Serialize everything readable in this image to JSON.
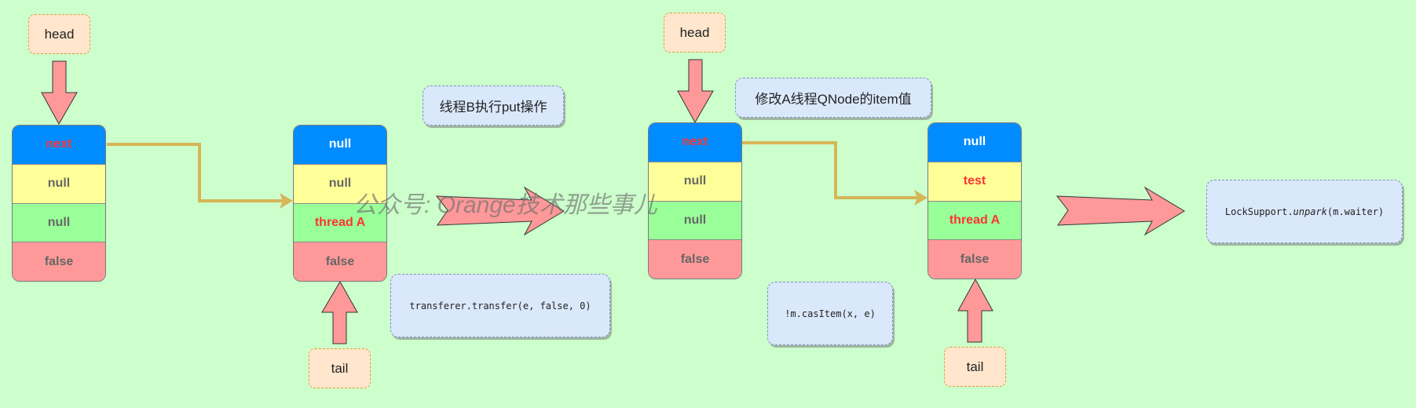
{
  "colors": {
    "background": "#CCFFCC",
    "next_row": "#008CFF",
    "item_row": "#FFFF99",
    "waiter_row": "#99FF99",
    "isData_row": "#FF9999",
    "pointer_box": "#FFE6CC",
    "note_box": "#DAE8FC",
    "connector": "#D6B656",
    "block_arrow": "#FF9999",
    "highlight_text": "#FF3333"
  },
  "diagram": {
    "nodes": [
      {
        "cells": [
          "next",
          "null",
          "null",
          "false"
        ],
        "red": [
          0
        ]
      },
      {
        "cells": [
          "null",
          "null",
          "thread A",
          "false"
        ],
        "red": [
          2
        ]
      },
      {
        "cells": [
          "next",
          "null",
          "null",
          "false"
        ],
        "red": [
          0
        ]
      },
      {
        "cells": [
          "null",
          "test",
          "thread A",
          "false"
        ],
        "red": [
          1,
          2
        ]
      }
    ],
    "pointers": [
      "head",
      "tail",
      "head",
      "tail"
    ],
    "notes": {
      "step1_label": "线程B执行put操作",
      "step1_code": "transferer.transfer(e, false, 0)",
      "step2_label": "修改A线程QNode的item值",
      "step2_code": "!m.casItem(x, e)",
      "step3_code_prefix": "LockSupport.",
      "step3_code_method": "unpark",
      "step3_code_suffix": "(m.waiter)"
    },
    "watermark": "公众号: Orange技术那些事儿"
  }
}
